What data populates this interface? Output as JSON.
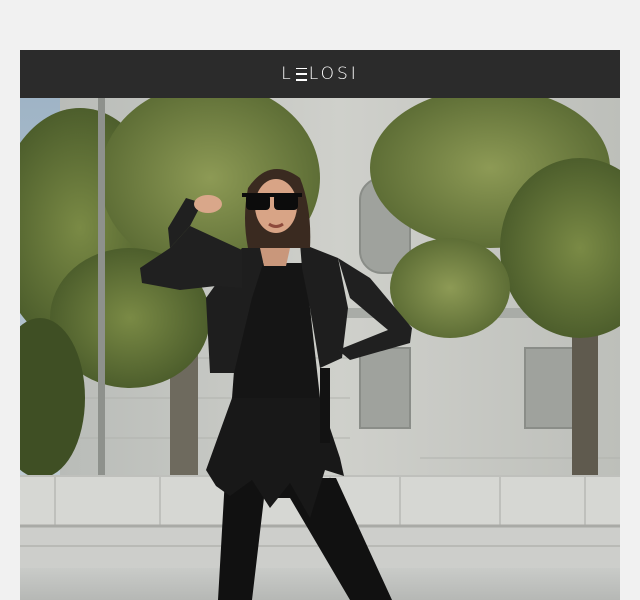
{
  "header": {
    "logo_text_start": "L",
    "logo_text_end": "LOSI"
  },
  "colors": {
    "page_background": "#f1f1f1",
    "header_background": "#2b2b2b",
    "logo": "#ffffff"
  }
}
